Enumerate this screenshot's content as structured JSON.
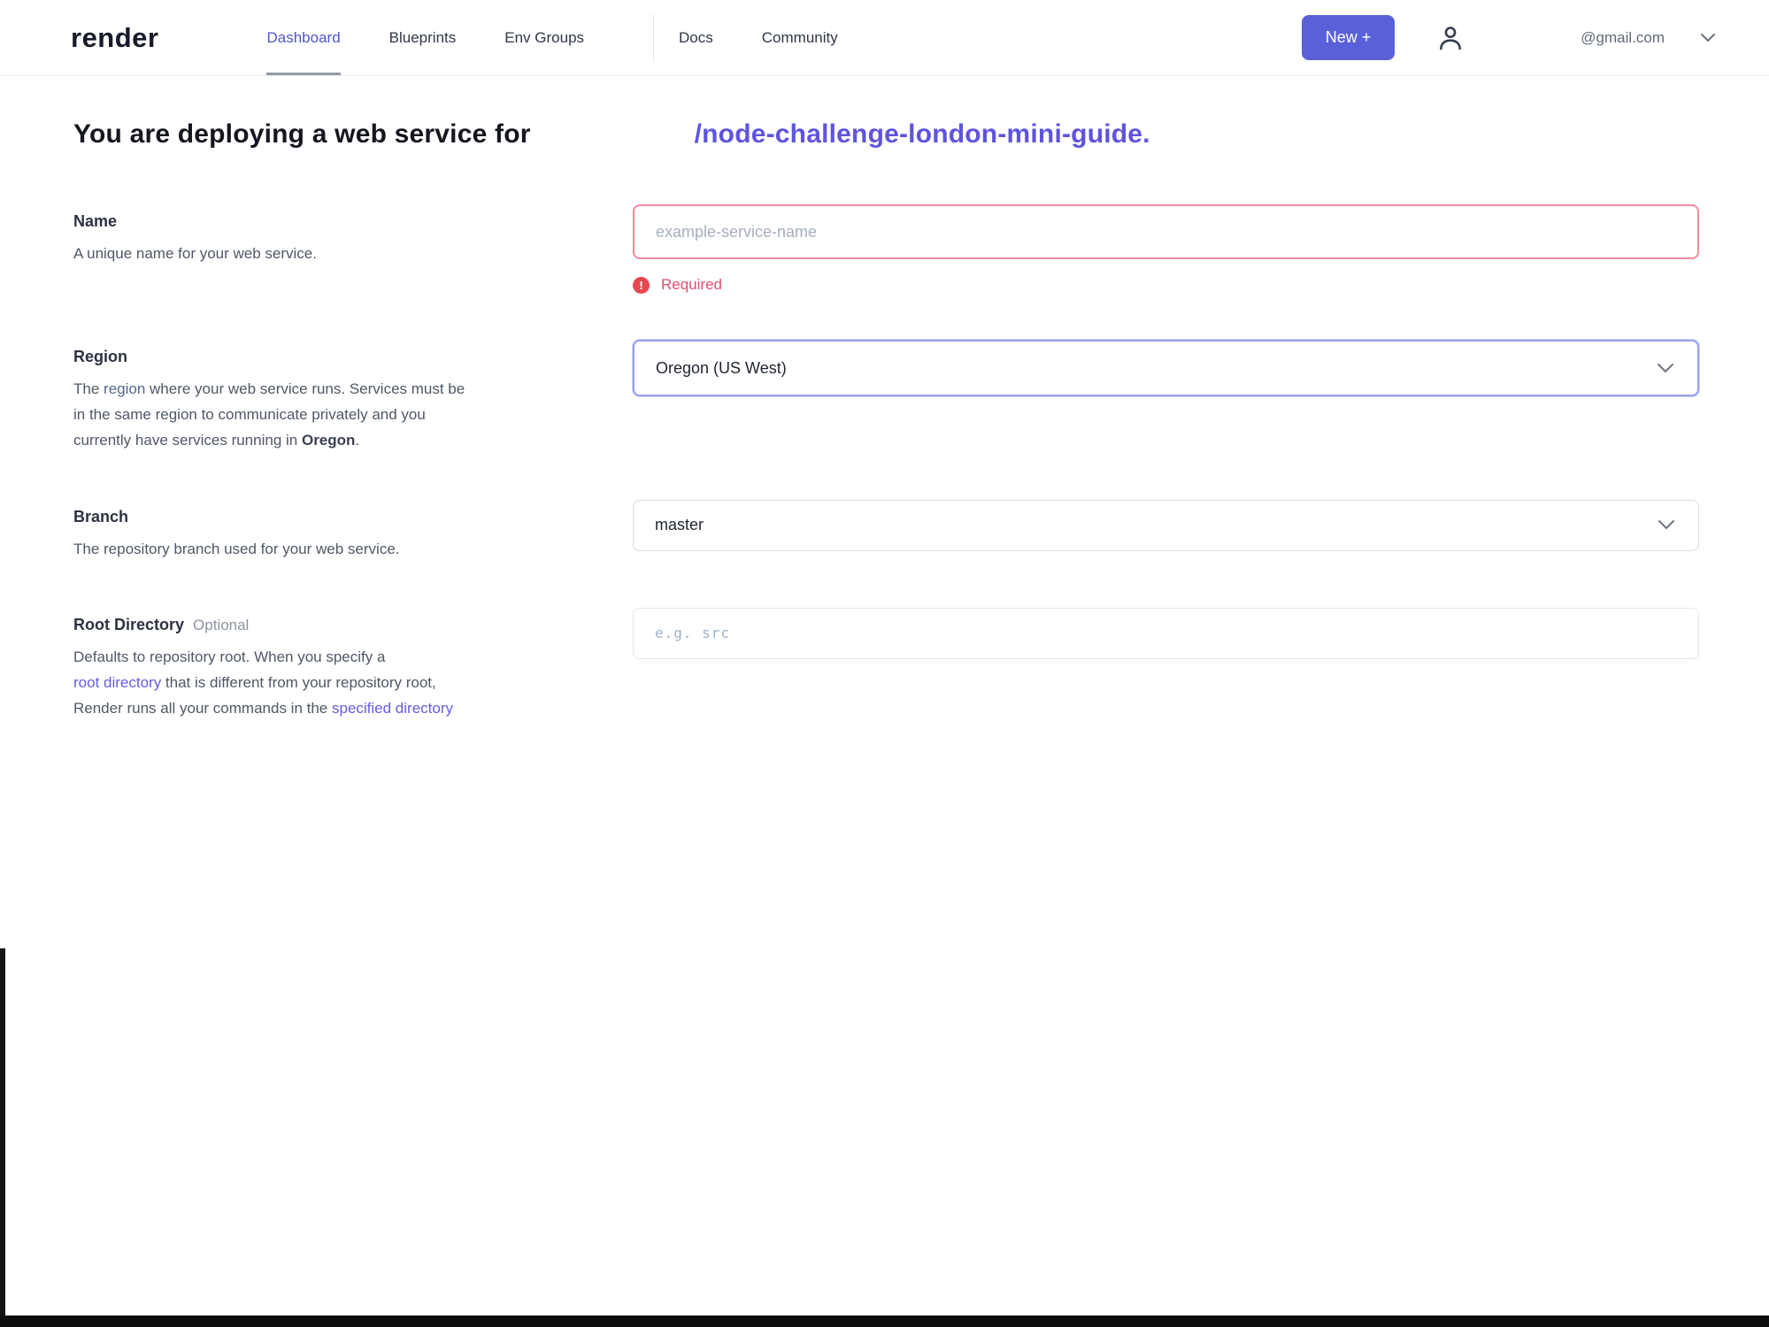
{
  "header": {
    "logo": "render",
    "nav": [
      {
        "label": "Dashboard"
      },
      {
        "label": "Blueprints"
      },
      {
        "label": "Env Groups"
      },
      {
        "label": "Docs"
      },
      {
        "label": "Community"
      }
    ],
    "new_button_label": "New +",
    "account_email": "@gmail.com",
    "icons": {
      "user": "user-icon",
      "caret": "chevron-down-icon",
      "plus": "+"
    }
  },
  "heading": {
    "prefix": "You are deploying a web service for",
    "repo_link": "/node-challenge-london-mini-guide."
  },
  "form": {
    "name": {
      "label": "Name",
      "description": "A unique name for your web service.",
      "placeholder": "example-service-name",
      "value": "",
      "error_icon": "!",
      "error_label": "Required"
    },
    "region": {
      "label": "Region",
      "desc_the": "The ",
      "desc_link": "region",
      "desc_line1_rest": " where your web service runs. Services must be",
      "desc_line2": "in the same region to communicate privately and you",
      "desc_line3_start": "currently have services running in ",
      "desc_bold": "Oregon",
      "desc_period": ".",
      "value": "Oregon (US West)"
    },
    "branch": {
      "label": "Branch",
      "description": "The repository branch used for your web service.",
      "value": "master"
    },
    "root_directory": {
      "label": "Root Directory",
      "optional_tag": "Optional",
      "desc_line1": "Defaults to repository root. When you specify a",
      "desc_link1": "root directory",
      "desc_mid": " that is different from your repository root,",
      "desc_line3_start": "Render runs all your commands in the ",
      "desc_link2": "specified directory",
      "placeholder": "e.g. src",
      "value": ""
    }
  },
  "colors": {
    "accent_purple": "#5a61d8",
    "nav_active_purple": "#5156ce",
    "repo_link_purple": "#5e54dd",
    "desc_link_purple": "#655ce0",
    "error_red": "#e5484d",
    "error_text_pink": "#e04f6e",
    "error_border_pink": "#ee8ba0",
    "focus_border_blue": "#98a3ea",
    "bottom_bar_black": "#0d0d0d"
  }
}
